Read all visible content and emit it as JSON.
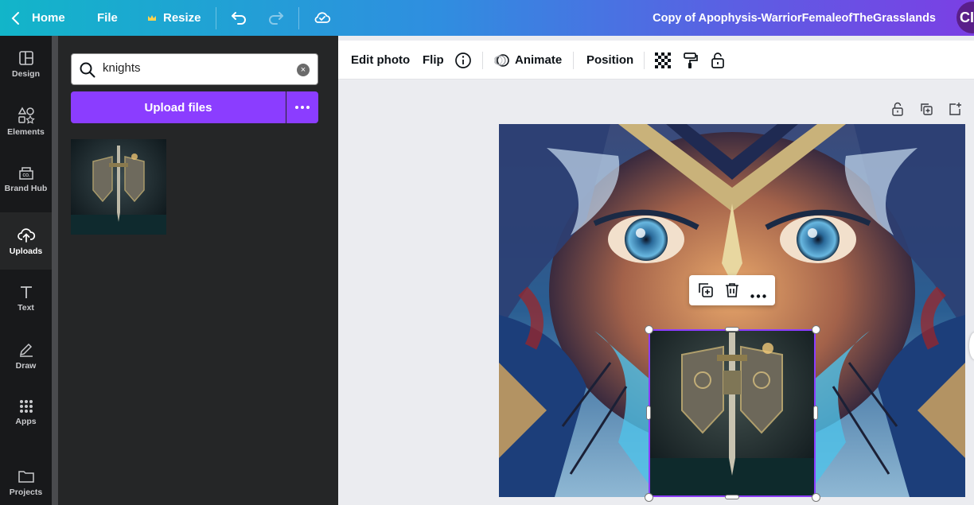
{
  "topbar": {
    "home_label": "Home",
    "file_label": "File",
    "resize_label": "Resize",
    "document_title": "Copy of Apophysis-WarriorFemaleofTheGrasslands",
    "avatar_initials": "CI",
    "colors": {
      "gradient_start": "#12b5c9",
      "gradient_end": "#7b3fe4"
    }
  },
  "rail": {
    "items": [
      {
        "label": "Design",
        "icon": "layout-icon"
      },
      {
        "label": "Elements",
        "icon": "shapes-icon"
      },
      {
        "label": "Brand Hub",
        "icon": "brand-kit-icon"
      },
      {
        "label": "Uploads",
        "icon": "cloud-upload-icon",
        "active": true
      },
      {
        "label": "Text",
        "icon": "text-icon"
      },
      {
        "label": "Draw",
        "icon": "pen-icon"
      },
      {
        "label": "Apps",
        "icon": "grid-icon"
      },
      {
        "label": "Projects",
        "icon": "folder-icon"
      }
    ]
  },
  "uploads_panel": {
    "search_value": "knights",
    "clear_icon": "×",
    "upload_button": "Upload files",
    "results": [
      {
        "kind": "image",
        "subject": "knight-shield-sword"
      }
    ],
    "accent": "#8b3dff"
  },
  "toolbar": {
    "edit_photo": "Edit photo",
    "flip": "Flip",
    "animate": "Animate",
    "position": "Position"
  },
  "selection": {
    "accent": "#8b3dff"
  }
}
